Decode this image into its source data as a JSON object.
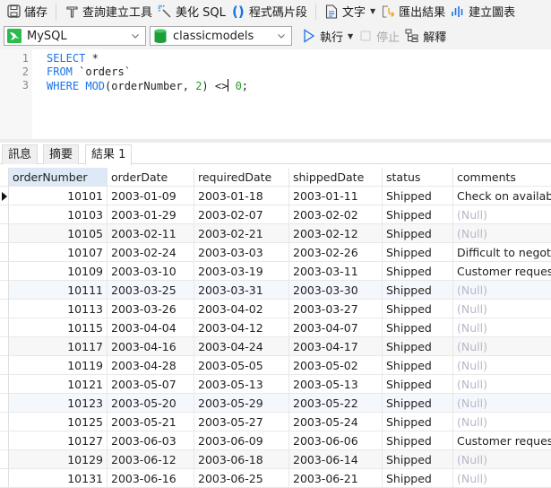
{
  "toolbar": {
    "save": "儲存",
    "query_builder": "查詢建立工具",
    "beautify": "美化 SQL",
    "snippets": "程式碼片段",
    "text": "文字",
    "export": "匯出結果",
    "chart": "建立圖表"
  },
  "connection": {
    "server": "MySQL",
    "database": "classicmodels",
    "run": "執行",
    "stop": "停止",
    "explain": "解釋"
  },
  "editor": {
    "lines": [
      {
        "number": "1",
        "parts": [
          {
            "t": "kw",
            "v": "SELECT"
          },
          {
            "t": "txt",
            "v": " *"
          }
        ]
      },
      {
        "number": "2",
        "parts": [
          {
            "t": "kw",
            "v": "FROM"
          },
          {
            "t": "txt",
            "v": " `orders`"
          }
        ]
      },
      {
        "number": "3",
        "parts": [
          {
            "t": "kw",
            "v": "WHERE MOD"
          },
          {
            "t": "txt",
            "v": "(orderNumber, "
          },
          {
            "t": "num",
            "v": "2"
          },
          {
            "t": "txt",
            "v": ") <>"
          },
          {
            "t": "cursor",
            "v": ""
          },
          {
            "t": "txt",
            "v": " "
          },
          {
            "t": "num",
            "v": "0"
          },
          {
            "t": "txt",
            "v": ";"
          }
        ]
      }
    ]
  },
  "tabs": [
    {
      "label": "訊息",
      "active": false
    },
    {
      "label": "摘要",
      "active": false
    },
    {
      "label": "結果 1",
      "active": true
    }
  ],
  "grid": {
    "columns": [
      "orderNumber",
      "orderDate",
      "requiredDate",
      "shippedDate",
      "status",
      "comments"
    ],
    "null_label": "(Null)",
    "rows": [
      [
        "10101",
        "2003-01-09",
        "2003-01-18",
        "2003-01-11",
        "Shipped",
        "Check on availabili"
      ],
      [
        "10103",
        "2003-01-29",
        "2003-02-07",
        "2003-02-02",
        "Shipped",
        null
      ],
      [
        "10105",
        "2003-02-11",
        "2003-02-21",
        "2003-02-12",
        "Shipped",
        null
      ],
      [
        "10107",
        "2003-02-24",
        "2003-03-03",
        "2003-02-26",
        "Shipped",
        "Difficult to negotia"
      ],
      [
        "10109",
        "2003-03-10",
        "2003-03-19",
        "2003-03-11",
        "Shipped",
        "Customer requeste"
      ],
      [
        "10111",
        "2003-03-25",
        "2003-03-31",
        "2003-03-30",
        "Shipped",
        null
      ],
      [
        "10113",
        "2003-03-26",
        "2003-04-02",
        "2003-03-27",
        "Shipped",
        null
      ],
      [
        "10115",
        "2003-04-04",
        "2003-04-12",
        "2003-04-07",
        "Shipped",
        null
      ],
      [
        "10117",
        "2003-04-16",
        "2003-04-24",
        "2003-04-17",
        "Shipped",
        null
      ],
      [
        "10119",
        "2003-04-28",
        "2003-05-05",
        "2003-05-02",
        "Shipped",
        null
      ],
      [
        "10121",
        "2003-05-07",
        "2003-05-13",
        "2003-05-13",
        "Shipped",
        null
      ],
      [
        "10123",
        "2003-05-20",
        "2003-05-29",
        "2003-05-22",
        "Shipped",
        null
      ],
      [
        "10125",
        "2003-05-21",
        "2003-05-27",
        "2003-05-24",
        "Shipped",
        null
      ],
      [
        "10127",
        "2003-06-03",
        "2003-06-09",
        "2003-06-06",
        "Shipped",
        "Customer requeste"
      ],
      [
        "10129",
        "2003-06-12",
        "2003-06-18",
        "2003-06-14",
        "Shipped",
        null
      ],
      [
        "10131",
        "2003-06-16",
        "2003-06-25",
        "2003-06-21",
        "Shipped",
        null
      ]
    ],
    "current_row": 0
  },
  "colors": {
    "keyword": "#1a73e8",
    "number": "#20a020",
    "null_text": "#b7b7c9",
    "sorted_header": "#dde9f6"
  }
}
